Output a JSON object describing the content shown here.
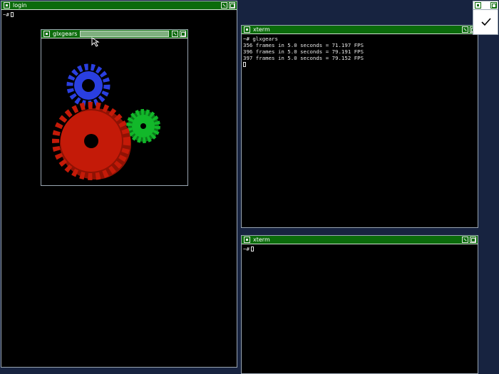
{
  "windows": {
    "login": {
      "title": "login",
      "prompt": "~#"
    },
    "glxgears": {
      "title": "glxgears"
    },
    "xterm_top": {
      "title": "xterm",
      "lines": [
        "~# glxgears",
        "356 frames in 5.0 seconds = 71.197 FPS",
        "396 frames in 5.0 seconds = 79.191 FPS",
        "397 frames in 5.0 seconds = 79.152 FPS"
      ]
    },
    "xterm_bottom": {
      "title": "xterm",
      "prompt": "~#"
    }
  },
  "colors": {
    "desktop": "#172340",
    "titlebar": "#0b6b0b",
    "red_gear": "#c41a08",
    "green_gear": "#12b82a",
    "blue_gear": "#2a3fe0"
  },
  "icons": [
    "window-menu-icon",
    "iconify-icon",
    "resize-icon",
    "checkmark-icon",
    "mouse-pointer-icon"
  ]
}
